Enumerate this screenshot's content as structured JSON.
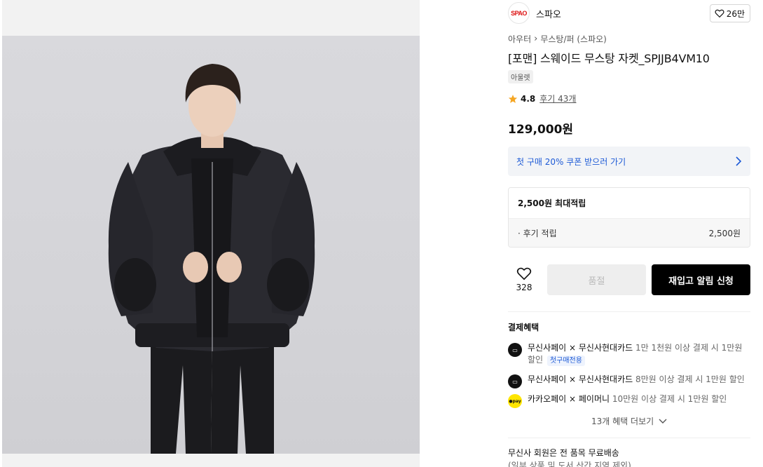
{
  "brand": {
    "logo_text": "SPAO",
    "name": "스파오",
    "likes": "26만"
  },
  "breadcrumb": {
    "category": "아우터",
    "subcategory": "무스탕/퍼 (스파오)"
  },
  "product": {
    "title": "[포맨] 스웨이드 무스탕 자켓_SPJJB4VM10",
    "tag": "아울렛",
    "rating": "4.8",
    "reviews": "후기 43개",
    "price": "129,000원"
  },
  "coupon": {
    "label": "첫 구매 20% 쿠폰 받으러 가기"
  },
  "points": {
    "max_label": "2,500원 최대적립",
    "review_label": "· 후기 적립",
    "review_value": "2,500원"
  },
  "actions": {
    "wish_count": "328",
    "soldout_label": "품절",
    "restock_label": "재입고 알림 신청"
  },
  "benefits": {
    "title": "결제혜택",
    "items": [
      {
        "icon": "musinsa-pay-icon",
        "main": "무신사페이 × 무신사현대카드",
        "detail": "1만 1천원 이상 결제 시 1만원 할인",
        "badge": "첫구매전용"
      },
      {
        "icon": "musinsa-pay-icon",
        "main": "무신사페이 × 무신사현대카드",
        "detail": "8만원 이상 결제 시 1만원 할인"
      },
      {
        "icon": "kakao-pay-icon",
        "icon_text": "●pay",
        "main": "카카오페이 × 페이머니",
        "detail": "10만원 이상 결제 시 1만원 할인"
      }
    ],
    "more_label": "13개 혜택 더보기"
  },
  "shipping": {
    "label": "무신사 회원은 전 품목 무료배송",
    "note": "(일부 상품 및 도서 산간 지역 제외)"
  },
  "colors": {
    "accent_blue": "#1d5ad6",
    "star": "#f5a623",
    "brand_red": "#dd1111",
    "restock_button": "#000000",
    "soldout_button": "#eeeeee"
  }
}
